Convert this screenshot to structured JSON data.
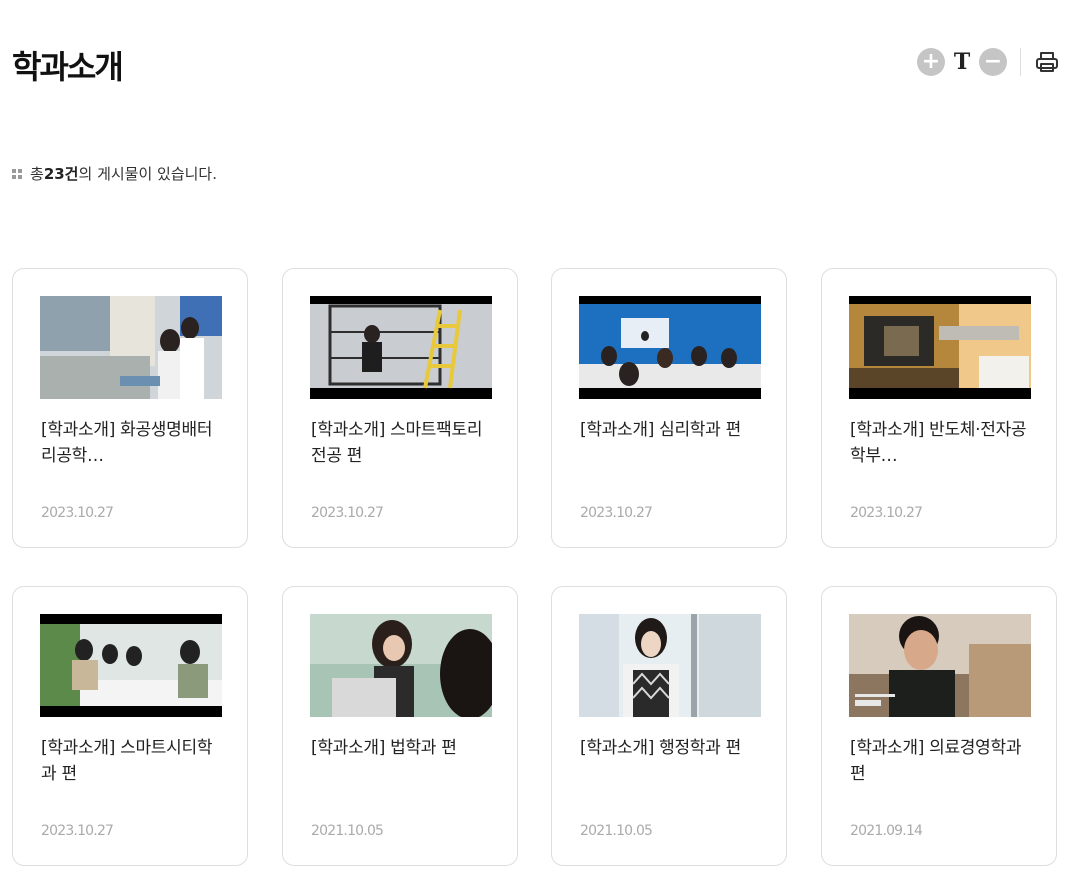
{
  "header": {
    "title": "학과소개"
  },
  "tools": {
    "zoom_in": "+",
    "text_size": "T",
    "zoom_out": "−"
  },
  "summary": {
    "prefix": "총 ",
    "count": "23건",
    "suffix": "의 게시물이 있습니다."
  },
  "cards": [
    {
      "title": "[학과소개] 화공생명배터리공학…",
      "date": "2023.10.27"
    },
    {
      "title": "[학과소개] 스마트팩토리전공 편",
      "date": "2023.10.27"
    },
    {
      "title": "[학과소개] 심리학과 편",
      "date": "2023.10.27"
    },
    {
      "title": "[학과소개] 반도체·전자공학부…",
      "date": "2023.10.27"
    },
    {
      "title": "[학과소개] 스마트시티학과 편",
      "date": "2023.10.27"
    },
    {
      "title": "[학과소개] 법학과 편",
      "date": "2021.10.05"
    },
    {
      "title": "[학과소개] 행정학과 편",
      "date": "2021.10.05"
    },
    {
      "title": "[학과소개] 의료경영학과 편",
      "date": "2021.09.14"
    }
  ],
  "icons": {
    "zoom_in": "plus-circle-icon",
    "zoom_out": "minus-circle-icon",
    "text": "text-size-icon",
    "print": "printer-icon",
    "bullet": "grid-dots-icon"
  },
  "colors": {
    "button_gray": "#c5c5c5",
    "card_border": "#dedede",
    "date_gray": "#aaaaaa"
  }
}
